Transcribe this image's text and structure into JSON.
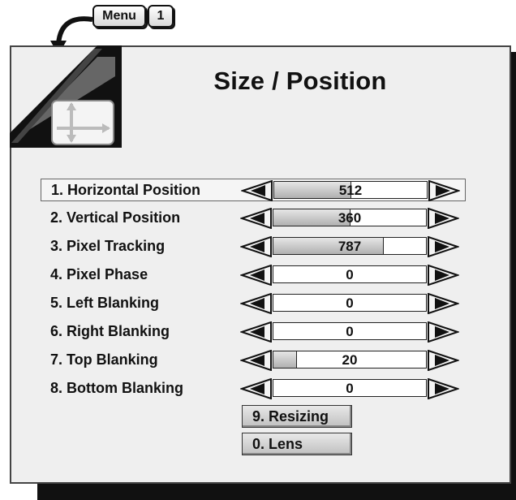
{
  "keys": {
    "menu": "Menu",
    "one": "1"
  },
  "title": "Size / Position",
  "rows": [
    {
      "label": "1. Horizontal Position",
      "value": "512",
      "level": 0.5,
      "selected": true
    },
    {
      "label": "2. Vertical Position",
      "value": "360",
      "level": 0.5,
      "selected": false
    },
    {
      "label": "3. Pixel Tracking",
      "value": "787",
      "level": 0.72,
      "selected": false
    },
    {
      "label": "4. Pixel Phase",
      "value": "0",
      "level": 0,
      "selected": false
    },
    {
      "label": "5. Left Blanking",
      "value": "0",
      "level": 0,
      "selected": false
    },
    {
      "label": "6. Right Blanking",
      "value": "0",
      "level": 0,
      "selected": false
    },
    {
      "label": "7. Top Blanking",
      "value": "20",
      "level": 0.15,
      "selected": false
    },
    {
      "label": "8. Bottom Blanking",
      "value": "0",
      "level": 0,
      "selected": false
    }
  ],
  "buttons": {
    "resizing": "9. Resizing",
    "lens": "0. Lens"
  },
  "icons": {
    "corner": "move-arrows-icon",
    "hint": "curved-arrow-icon",
    "left": "left-arrow-icon",
    "right": "right-arrow-icon"
  }
}
